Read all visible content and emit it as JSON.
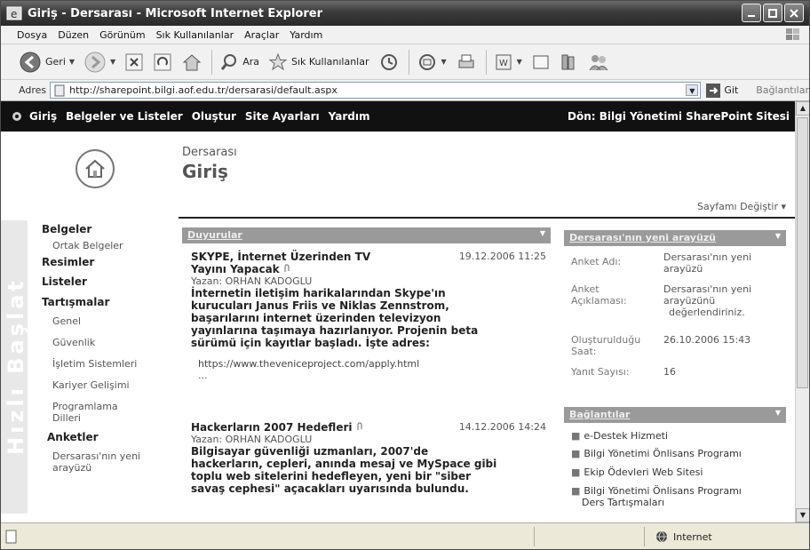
{
  "window": {
    "title": "Giriş - Dersarası - Microsoft Internet Explorer"
  },
  "menu": [
    "Dosya",
    "Düzen",
    "Görünüm",
    "Sık Kullanılanlar",
    "Araçlar",
    "Yardım"
  ],
  "toolbar": {
    "back": "Geri",
    "search": "Ara",
    "favorites": "Sık Kullanılanlar"
  },
  "address": {
    "label": "Adres",
    "url": "http://sharepoint.bilgi.aof.edu.tr/dersarasi/default.aspx",
    "go": "Git",
    "links": "Bağlantılar"
  },
  "topnav": {
    "items": [
      "Giriş",
      "Belgeler ve Listeler",
      "Oluştur",
      "Site Ayarları",
      "Yardım"
    ],
    "back": "Dön: Bilgi Yönetimi SharePoint Sitesi"
  },
  "header": {
    "site": "Dersarası",
    "title": "Giriş",
    "modify": "Sayfamı Değiştir ▾"
  },
  "quick": {
    "watermark": "Hızlı Başlat",
    "items": [
      {
        "label": "Belgeler",
        "type": "h"
      },
      {
        "label": "Ortak Belgeler",
        "type": "s"
      },
      {
        "label": "Resimler",
        "type": "h"
      },
      {
        "label": "Listeler",
        "type": "h"
      },
      {
        "label": "Tartışmalar",
        "type": "h"
      },
      {
        "label": "Genel",
        "type": "s"
      },
      {
        "label": "Güvenlik",
        "type": "s"
      },
      {
        "label": "İşletim Sistemleri",
        "type": "s"
      },
      {
        "label": "Kariyer Gelişimi",
        "type": "s"
      },
      {
        "label": "Programlama",
        "type": "s"
      },
      {
        "label": "Dilleri",
        "type": "s"
      },
      {
        "label": "Anketler",
        "type": "h"
      },
      {
        "label": "Dersarası'nın yeni",
        "type": "s"
      },
      {
        "label": "arayüzü",
        "type": "s"
      }
    ]
  },
  "announcements": {
    "title": "Duyurular",
    "items": [
      {
        "title": "SKYPE, İnternet Üzerinden TV",
        "title2": "Yayını Yapacak",
        "date": "19.12.2006 11:25",
        "author": "Yazan: ORHAN KADOGLU",
        "body": [
          "İnternetin iletişim harikalarından Skype'ın",
          "kurucuları Janus Friis ve Niklas Zennstrom,",
          "başarılarını internet üzerinden televizyon",
          "yayınlarına taşımaya hazırlanıyor. Projenin beta",
          "sürümü için kayıtlar başladı. İşte adres:"
        ],
        "url": "https://www.theveniceproject.com/apply.html",
        "more": "..."
      },
      {
        "title": "Hackerların 2007 Hedefleri",
        "date": "14.12.2006 14:24",
        "author": "Yazan: ORHAN KADOGLU",
        "body": [
          "Bilgisayar güvenliği uzmanları, 2007'de",
          "hackerların, cepleri, anında mesaj ve MySpace gibi",
          "toplu web sitelerini hedefleyen, yeni bir \"siber",
          "savaş cephesi\" açacakları uyarısında bulundu."
        ]
      }
    ]
  },
  "poll": {
    "title": "Dersarası'nın yeni arayüzü",
    "rows": [
      {
        "label": [
          "Anket Adı:"
        ],
        "value": [
          "Dersarası'nın yeni",
          "arayüzü"
        ]
      },
      {
        "label": [
          "Anket",
          "Açıklaması:"
        ],
        "value": [
          "Dersarası'nın yeni",
          "arayüzünü",
          "değerlendiriniz."
        ]
      },
      {
        "label": [
          "Oluşturulduğu",
          "Saat:"
        ],
        "value": [
          "26.10.2006 15:43"
        ]
      },
      {
        "label": [
          "Yanıt Sayısı:"
        ],
        "value": [
          "16"
        ]
      }
    ]
  },
  "links": {
    "title": "Bağlantılar",
    "items": [
      "e-Destek Hizmeti",
      "Bilgi Yönetimi Önlisans Programı",
      "Ekip Ödevleri Web Sitesi",
      "Bilgi Yönetimi Önlisans Programı",
      "Ders Tartışmaları"
    ]
  },
  "status": {
    "zone": "Internet"
  }
}
